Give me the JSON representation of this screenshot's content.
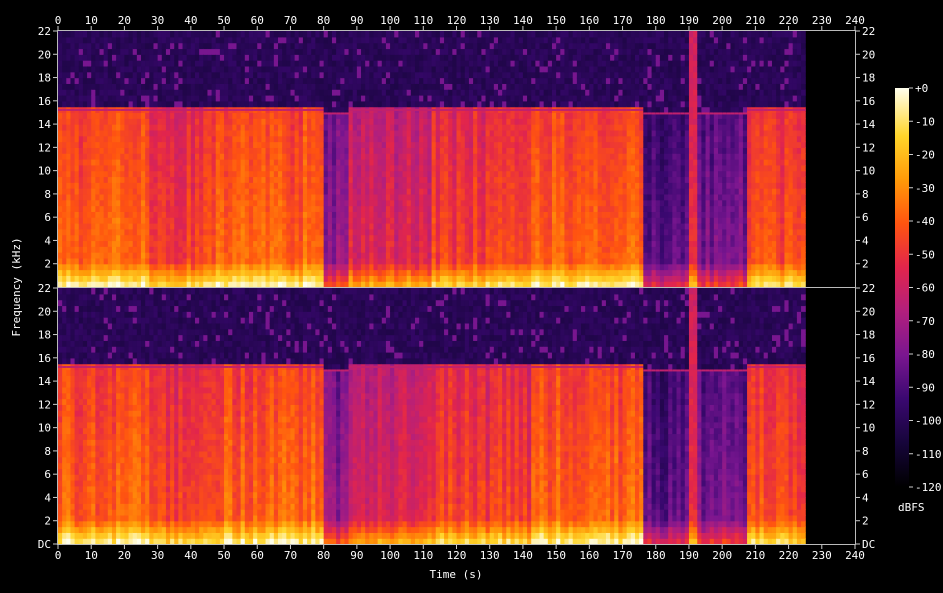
{
  "chart_data": {
    "type": "heatmap",
    "title": "",
    "xlabel": "Time (s)",
    "ylabel": "Frequency (kHz)",
    "x_ticks": [
      "0",
      "10",
      "20",
      "30",
      "40",
      "50",
      "60",
      "70",
      "80",
      "90",
      "100",
      "110",
      "120",
      "130",
      "140",
      "150",
      "160",
      "170",
      "180",
      "190",
      "200",
      "210",
      "220",
      "230",
      "240"
    ],
    "xlim": [
      0,
      240
    ],
    "y_ticks_top": [
      "2",
      "4",
      "6",
      "8",
      "10",
      "12",
      "14",
      "16",
      "18",
      "20",
      "22"
    ],
    "y_ticks_bottom": [
      "DC",
      "2",
      "4",
      "6",
      "8",
      "10",
      "12",
      "14",
      "16",
      "18",
      "20",
      "22"
    ],
    "ylim_khz": [
      0,
      22
    ],
    "channels": 2,
    "audio_end_s": 225,
    "colorbar": {
      "label": "dBFS",
      "ticks": [
        "+0",
        "-10",
        "-20",
        "-30",
        "-40",
        "-50",
        "-60",
        "-70",
        "-80",
        "-90",
        "-100",
        "-110",
        "-120"
      ],
      "range_db": [
        -120,
        0
      ]
    },
    "colormap": [
      "#000000",
      "#16053a",
      "#3a0870",
      "#7a1690",
      "#b21f7d",
      "#e2254c",
      "#ff5410",
      "#ff9a08",
      "#ffd52a",
      "#ffffee"
    ],
    "segments": [
      {
        "t": [
          0,
          28
        ],
        "cutoff_khz": 15.3,
        "level": 0.7
      },
      {
        "t": [
          28,
          45
        ],
        "cutoff_khz": 15.3,
        "level": 0.62
      },
      {
        "t": [
          45,
          80
        ],
        "cutoff_khz": 15.3,
        "level": 0.7
      },
      {
        "t": [
          80,
          88
        ],
        "cutoff_khz": 15.0,
        "level": 0.4
      },
      {
        "t": [
          88,
          112
        ],
        "cutoff_khz": 15.3,
        "level": 0.55
      },
      {
        "t": [
          112,
          143
        ],
        "cutoff_khz": 15.3,
        "level": 0.63
      },
      {
        "t": [
          143,
          176
        ],
        "cutoff_khz": 15.3,
        "level": 0.7
      },
      {
        "t": [
          176,
          190
        ],
        "cutoff_khz": 15.0,
        "level": 0.3
      },
      {
        "t": [
          190,
          193
        ],
        "cutoff_khz": 22.0,
        "level": 0.62
      },
      {
        "t": [
          193,
          208
        ],
        "cutoff_khz": 15.0,
        "level": 0.35
      },
      {
        "t": [
          208,
          225
        ],
        "cutoff_khz": 15.3,
        "level": 0.66
      }
    ]
  }
}
